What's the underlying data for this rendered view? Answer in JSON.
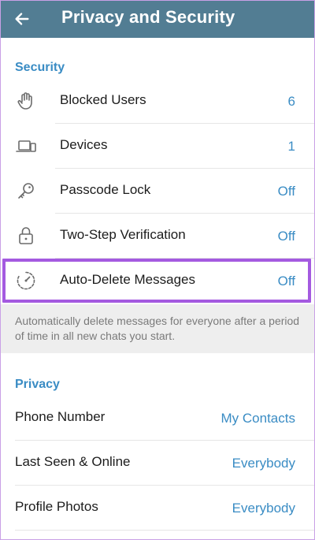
{
  "header": {
    "title": "Privacy and Security",
    "back_icon": "arrow-left-icon"
  },
  "colors": {
    "header_bg": "#527d93",
    "accent": "#3a8cc4",
    "highlight_border": "#a45ae0"
  },
  "security": {
    "heading": "Security",
    "items": [
      {
        "label": "Blocked Users",
        "value": "6",
        "icon": "hand-icon"
      },
      {
        "label": "Devices",
        "value": "1",
        "icon": "devices-icon"
      },
      {
        "label": "Passcode Lock",
        "value": "Off",
        "icon": "key-icon"
      },
      {
        "label": "Two-Step Verification",
        "value": "Off",
        "icon": "lock-icon"
      },
      {
        "label": "Auto-Delete Messages",
        "value": "Off",
        "icon": "timer-icon"
      }
    ],
    "auto_delete_info": "Automatically delete messages for everyone after a period of time in all new chats you start."
  },
  "privacy": {
    "heading": "Privacy",
    "items": [
      {
        "label": "Phone Number",
        "value": "My Contacts"
      },
      {
        "label": "Last Seen & Online",
        "value": "Everybody"
      },
      {
        "label": "Profile Photos",
        "value": "Everybody"
      }
    ]
  }
}
